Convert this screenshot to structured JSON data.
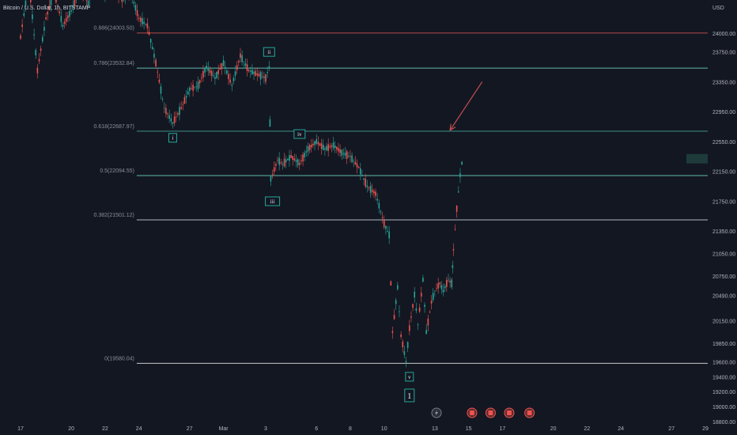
{
  "header": {
    "title": "Bitcoin / U.S. Dollar, 1h, BITSTAMP"
  },
  "axis": {
    "currency": "USD"
  },
  "chart_data": {
    "type": "candlestick",
    "ylim": [
      18800,
      24350
    ],
    "price_ticks": [
      "24000.00",
      "23750.00",
      "23350.00",
      "22950.00",
      "22550.00",
      "22150.00",
      "21750.00",
      "21350.00",
      "21050.00",
      "20750.00",
      "20490.00",
      "20150.00",
      "19850.00",
      "19600.00",
      "19400.00",
      "19200.00",
      "19000.00",
      "18800.00"
    ],
    "date_ticks": [
      "17",
      "20",
      "22",
      "24",
      "27",
      "Mar",
      "3",
      "6",
      "8",
      "10",
      "13",
      "15",
      "17",
      "20",
      "22",
      "24",
      "27",
      "29"
    ],
    "fib_levels": [
      {
        "label": "0.886(24003.50)",
        "price": 24003.5,
        "color": "#b24a4a"
      },
      {
        "label": "0.786(23532.84)",
        "price": 23532.84,
        "color": "#5fb8ac"
      },
      {
        "label": "0.618(22687.97)",
        "price": 22687.97,
        "color": "#3f8f88"
      },
      {
        "label": "0.5(22094.55)",
        "price": 22094.55,
        "color": "#5fb8ac"
      },
      {
        "label": "0.382(21501.12)",
        "price": 21501.12,
        "color": "#b2b5be"
      },
      {
        "label": "0(19580.04)",
        "price": 19580.04,
        "color": "#c8c8c8"
      }
    ],
    "waves": [
      {
        "label": "i",
        "date": "25",
        "price": 22600
      },
      {
        "label": "ii",
        "date": "3",
        "price": 23800
      },
      {
        "label": "iii",
        "date": "3",
        "price": 21950
      },
      {
        "label": "iv",
        "date": "5",
        "price": 22700
      },
      {
        "label": "v",
        "date": "10",
        "price": 19400
      },
      {
        "label": "1",
        "date": "10",
        "price": 19200
      }
    ],
    "price_path": [
      [
        16.5,
        23950
      ],
      [
        17.0,
        24700
      ],
      [
        17.5,
        23500
      ],
      [
        18.0,
        24200
      ],
      [
        18.5,
        24550
      ],
      [
        19.0,
        24100
      ],
      [
        19.5,
        24300
      ],
      [
        20.0,
        24600
      ],
      [
        20.5,
        24400
      ],
      [
        21.0,
        24700
      ],
      [
        21.5,
        24500
      ],
      [
        22.0,
        24600
      ],
      [
        22.5,
        24450
      ],
      [
        23.0,
        24550
      ],
      [
        23.5,
        24200
      ],
      [
        24.0,
        24100
      ],
      [
        24.5,
        23600
      ],
      [
        25.0,
        23000
      ],
      [
        25.5,
        22800
      ],
      [
        26.0,
        23000
      ],
      [
        26.5,
        23250
      ],
      [
        27.0,
        23300
      ],
      [
        27.5,
        23550
      ],
      [
        28.0,
        23400
      ],
      [
        28.5,
        23600
      ],
      [
        29.0,
        23300
      ],
      [
        29.5,
        23700
      ],
      [
        30.0,
        23500
      ],
      [
        30.5,
        23450
      ],
      [
        31.0,
        23400
      ],
      [
        31.2,
        23550
      ],
      [
        31.3,
        22050
      ],
      [
        31.7,
        22300
      ],
      [
        32.0,
        22250
      ],
      [
        32.5,
        22350
      ],
      [
        33.0,
        22250
      ],
      [
        33.5,
        22450
      ],
      [
        34.0,
        22550
      ],
      [
        34.5,
        22450
      ],
      [
        35.0,
        22500
      ],
      [
        35.5,
        22400
      ],
      [
        36.0,
        22350
      ],
      [
        36.5,
        22200
      ],
      [
        37.0,
        21950
      ],
      [
        37.5,
        21850
      ],
      [
        38.0,
        21450
      ],
      [
        38.3,
        21300
      ],
      [
        38.5,
        20000
      ],
      [
        38.8,
        20600
      ],
      [
        39.0,
        19950
      ],
      [
        39.3,
        19600
      ],
      [
        39.5,
        20050
      ],
      [
        39.8,
        20500
      ],
      [
        40.0,
        20100
      ],
      [
        40.3,
        20700
      ],
      [
        40.5,
        20000
      ],
      [
        40.8,
        20400
      ],
      [
        41.0,
        20550
      ],
      [
        41.3,
        20650
      ],
      [
        41.5,
        20550
      ],
      [
        41.8,
        20700
      ],
      [
        42.0,
        20650
      ],
      [
        42.1,
        21100
      ],
      [
        42.3,
        21650
      ],
      [
        42.5,
        22100
      ],
      [
        42.7,
        22420
      ]
    ],
    "annotations": [
      {
        "type": "arrow",
        "color": "#c2504e",
        "from": [
          "14.7",
          23350
        ],
        "to": [
          "13.5",
          22700
        ]
      },
      {
        "type": "price_flag",
        "price": 22320
      }
    ],
    "footer_icons": [
      "lightning-icon",
      "flag-icon",
      "flag-icon",
      "flag-icon",
      "flag-icon"
    ]
  }
}
